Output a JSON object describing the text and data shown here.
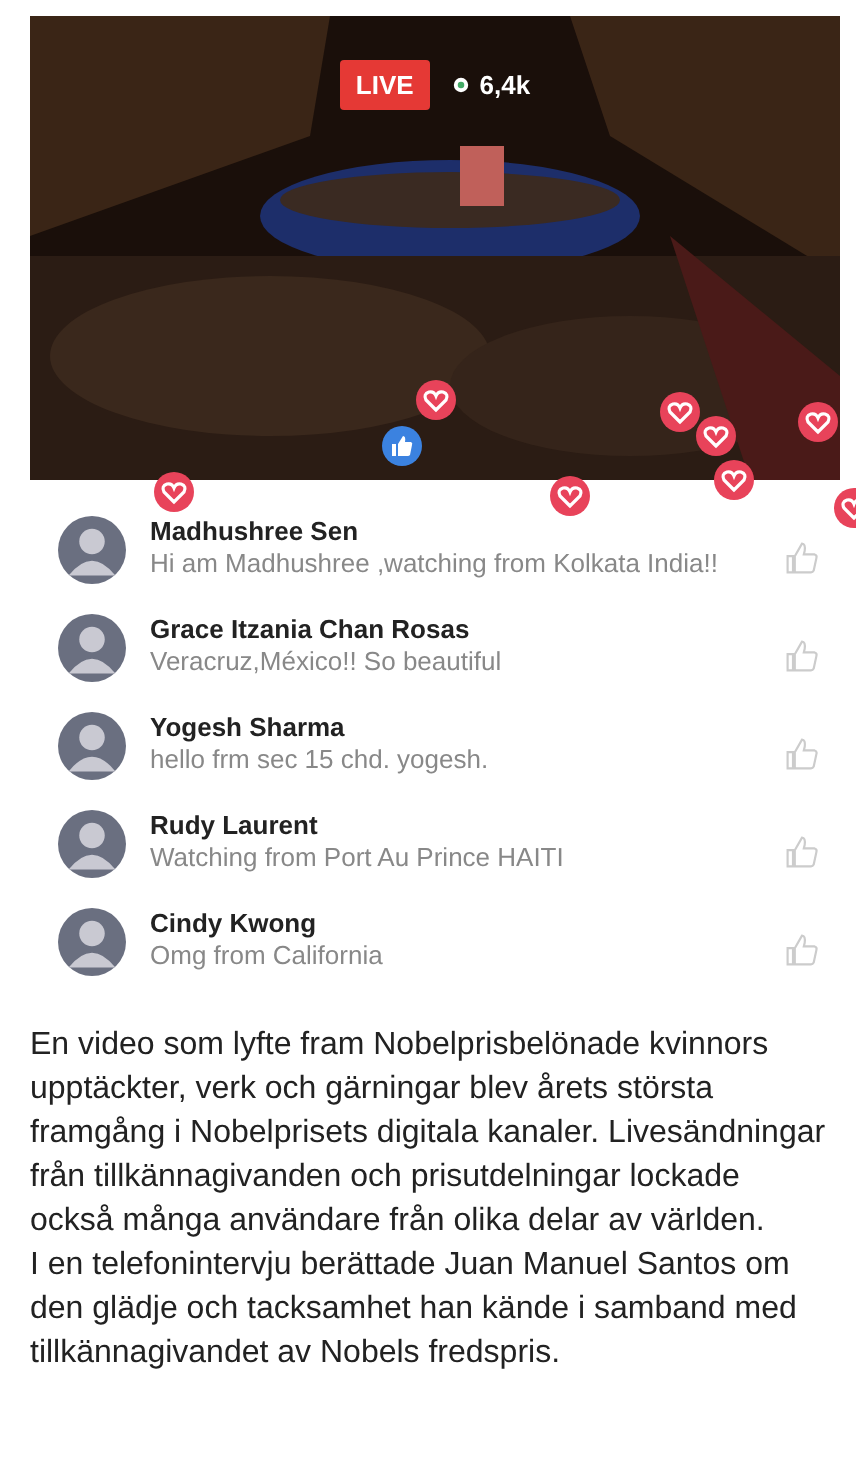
{
  "video": {
    "kind": "picture",
    "live_badge": "LIVE",
    "viewers": "6,4k"
  },
  "comments": [
    {
      "name": "Madhushree Sen",
      "text": "Hi am Madhushree  ,watching from Kolkata India!!"
    },
    {
      "name": "Grace Itzania Chan Rosas",
      "text": "Veracruz,México!! So beautiful"
    },
    {
      "name": "Yogesh Sharma",
      "text": "hello frm sec 15 chd. yogesh."
    },
    {
      "name": "Rudy Laurent",
      "text": "Watching from Port Au Prince HAITI"
    },
    {
      "name": "Cindy Kwong",
      "text": "Omg from California"
    }
  ],
  "article": {
    "paragraphs": [
      "En video som lyfte fram Nobelprisbelönade kvinnors upptäckter, verk och gärningar blev årets största framgång i Nobelprisets digitala kanaler. Livesändningar från tillkännagivanden och prisutdelningar lockade också många användare från olika delar av världen.",
      "I en telefonintervju berättade Juan Manuel Santos om den glädje och tacksamhet han kände i samband med tillkännagivandet av Nobels fredspris."
    ]
  }
}
